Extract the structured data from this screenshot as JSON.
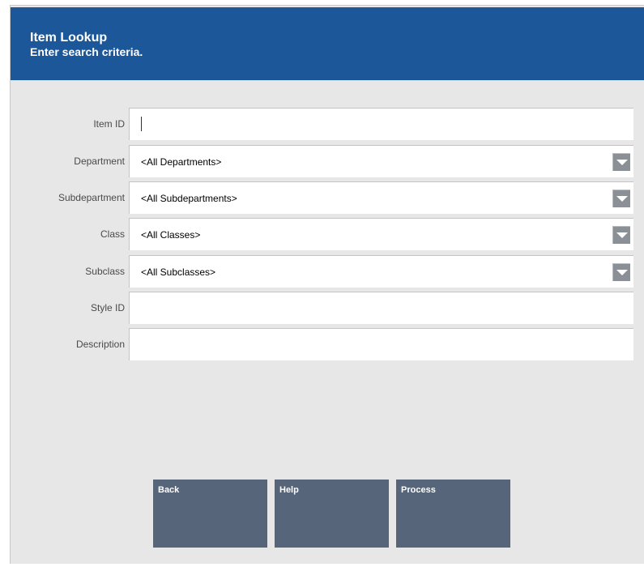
{
  "header": {
    "title": "Item Lookup",
    "subtitle": "Enter search criteria."
  },
  "fields": {
    "item_id": {
      "label": "Item ID",
      "value": ""
    },
    "department": {
      "label": "Department",
      "value": "<All Departments>"
    },
    "subdepartment": {
      "label": "Subdepartment",
      "value": "<All Subdepartments>"
    },
    "class": {
      "label": "Class",
      "value": "<All Classes>"
    },
    "subclass": {
      "label": "Subclass",
      "value": "<All Subclasses>"
    },
    "style_id": {
      "label": "Style ID",
      "value": ""
    },
    "description": {
      "label": "Description",
      "value": ""
    }
  },
  "buttons": {
    "back": "Back",
    "help": "Help",
    "process": "Process"
  },
  "colors": {
    "header_bg": "#1c5799",
    "button_bg": "#566579",
    "panel_bg": "#e7e7e7"
  },
  "icons": {
    "dropdown": "chevron-down-icon"
  }
}
